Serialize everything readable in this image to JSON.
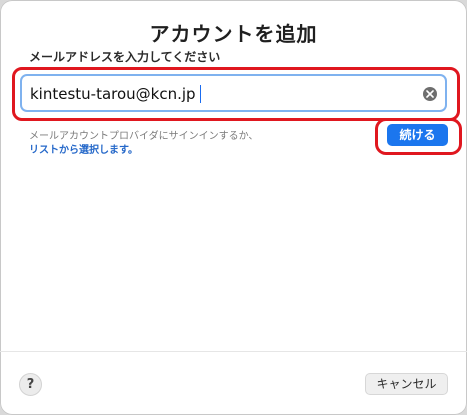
{
  "dialog": {
    "title": "アカウントを追加",
    "prompt": "メールアドレスを入力してください",
    "email": {
      "value": "kintestu-tarou@kcn.jp",
      "clear_icon": "clear-circle-x-icon"
    },
    "provider_text": "メールアカウントプロバイダにサインインするか、",
    "provider_link": "リストから選択します。",
    "continue_label": "続ける",
    "help_label": "?",
    "cancel_label": "キャンセル"
  },
  "colors": {
    "accent": "#1b76ee",
    "highlight": "#e0171f",
    "link": "#2568c9"
  }
}
